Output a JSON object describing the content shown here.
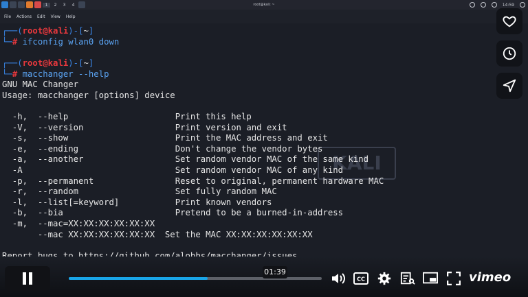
{
  "panel": {
    "workspaces": [
      "1",
      "2",
      "3",
      "4"
    ],
    "window_title": "root@kali: ~",
    "clock": "14:59"
  },
  "menu": [
    "File",
    "Actions",
    "Edit",
    "View",
    "Help"
  ],
  "terminal": {
    "prompt_user": "root",
    "prompt_at": "@",
    "prompt_host": "kali",
    "prompt_dir": "~",
    "cmd1": "ifconfig wlan0 down",
    "cmd2": "macchanger --help",
    "output": [
      "GNU MAC Changer",
      "Usage: macchanger [options] device",
      "",
      "  -h,  --help                     Print this help",
      "  -V,  --version                  Print version and exit",
      "  -s,  --show                     Print the MAC address and exit",
      "  -e,  --ending                   Don't change the vendor bytes",
      "  -a,  --another                  Set random vendor MAC of the same kind",
      "  -A                              Set random vendor MAC of any kind",
      "  -p,  --permanent                Reset to original, permanent hardware MAC",
      "  -r,  --random                   Set fully random MAC",
      "  -l,  --list[=keyword]           Print known vendors",
      "  -b,  --bia                      Pretend to be a burned-in-address",
      "  -m,  --mac=XX:XX:XX:XX:XX:XX",
      "       --mac XX:XX:XX:XX:XX:XX  Set the MAC XX:XX:XX:XX:XX:XX",
      "",
      "Report bugs to https://github.com/alobbs/macchanger/issues"
    ],
    "watermark": "KALI"
  },
  "side_buttons": [
    "heart-icon",
    "clock-icon",
    "send-icon"
  ],
  "player": {
    "time_tooltip": "01:39",
    "progress": 0.55,
    "brand": "vimeo",
    "accent": "#19a5e8"
  }
}
